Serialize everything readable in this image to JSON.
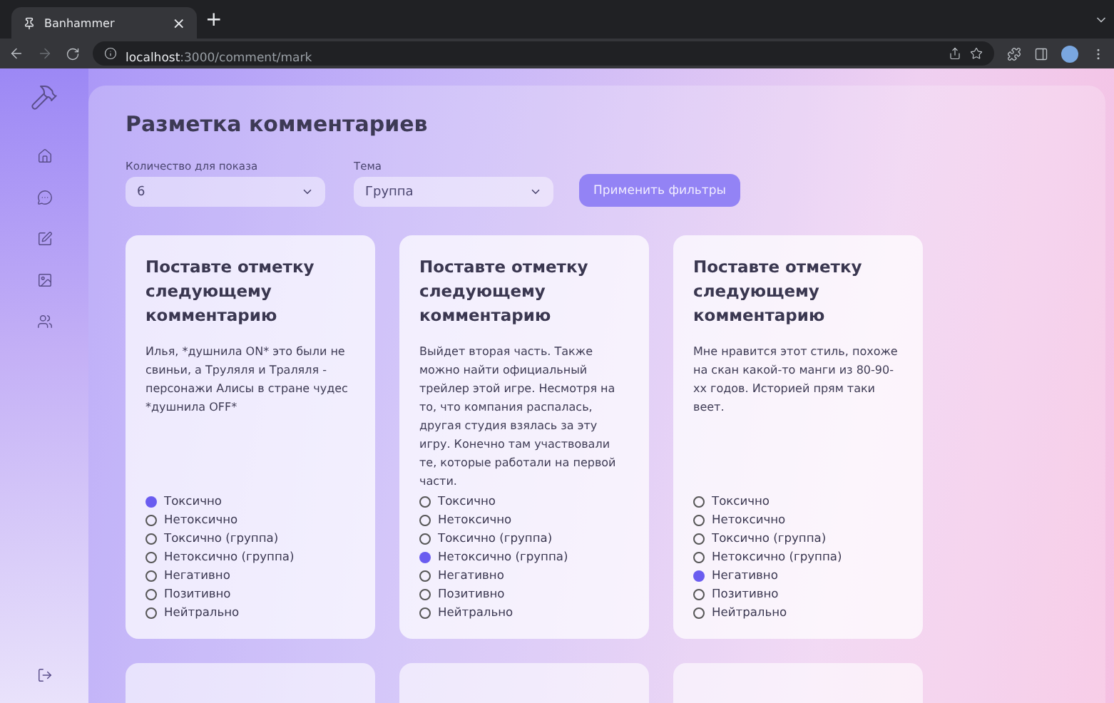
{
  "browser": {
    "tab_title": "Banhammer",
    "tab_close": "×",
    "new_tab": "+",
    "url_host": "localhost",
    "url_path": ":3000/comment/mark"
  },
  "page": {
    "title": "Разметка комментариев",
    "filters": [
      {
        "label": "Количество для показа",
        "value": "6"
      },
      {
        "label": "Тема",
        "value": "Группа"
      }
    ],
    "apply_button": "Применить фильтры",
    "cards": [
      {
        "title": "Поставте отметку следующему комментарию",
        "comment": "Илья, *душнила ON* это были не свиньи, а Труляля и Траляля - персонажи Алисы в стране чудес *душнила OFF*",
        "options": [
          {
            "label": "Токсично",
            "selected": true
          },
          {
            "label": "Нетоксично",
            "selected": false
          },
          {
            "label": "Токсично (группа)",
            "selected": false
          },
          {
            "label": "Нетоксично (группа)",
            "selected": false
          },
          {
            "label": "Негативно",
            "selected": false
          },
          {
            "label": "Позитивно",
            "selected": false
          },
          {
            "label": "Нейтрально",
            "selected": false
          }
        ]
      },
      {
        "title": "Поставте отметку следующему комментарию",
        "comment": "Выйдет вторая часть. Также можно найти официальный трейлер этой игре. Несмотря на то, что компания распалась, другая студия взялась за эту игру. Конечно там участвовали те, которые работали на первой части.",
        "options": [
          {
            "label": "Токсично",
            "selected": false
          },
          {
            "label": "Нетоксично",
            "selected": false
          },
          {
            "label": "Токсично (группа)",
            "selected": false
          },
          {
            "label": "Нетоксично (группа)",
            "selected": true
          },
          {
            "label": "Негативно",
            "selected": false
          },
          {
            "label": "Позитивно",
            "selected": false
          },
          {
            "label": "Нейтрально",
            "selected": false
          }
        ]
      },
      {
        "title": "Поставте отметку следующему комментарию",
        "comment": "Мне нравится этот стиль, похоже на скан какой-то манги из 80-90-хх годов. Историей прям таки веет.",
        "options": [
          {
            "label": "Токсично",
            "selected": false
          },
          {
            "label": "Нетоксично",
            "selected": false
          },
          {
            "label": "Токсично (группа)",
            "selected": false
          },
          {
            "label": "Нетоксично (группа)",
            "selected": false
          },
          {
            "label": "Негативно",
            "selected": true
          },
          {
            "label": "Позитивно",
            "selected": false
          },
          {
            "label": "Нейтрально",
            "selected": false
          }
        ]
      }
    ]
  }
}
